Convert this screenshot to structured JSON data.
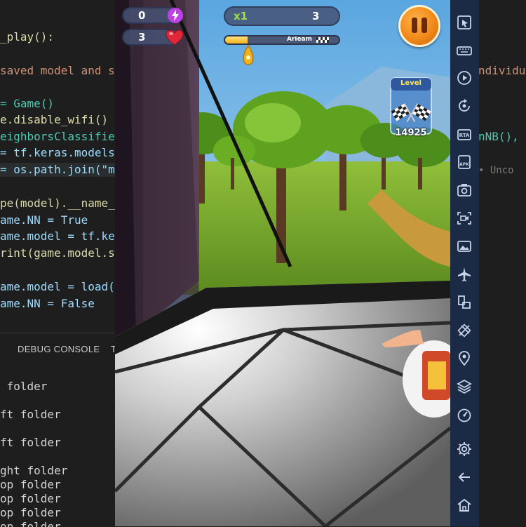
{
  "editor": {
    "code_lines": [
      "_play():",
      "",
      "saved model and s",
      "",
      "= Game()",
      "e.disable_wifi()",
      "eighborsClassifie",
      "= tf.keras.models",
      "= os.path.join(\"mo",
      "",
      "pe(model).__name__",
      "ame.NN = True",
      "ame.model = tf.ker",
      "rint(game.model.su",
      "",
      "ame.model = load(p",
      "ame.NN = False"
    ],
    "right_fragments": [
      "ndividu",
      "nNB(),",
      "• Unco"
    ]
  },
  "debug_panel": {
    "tab_label": "DEBUG CONSOLE",
    "tab_label_2": "T",
    "console_lines": [
      " folder",
      "ft folder",
      "ft folder",
      "ght folder",
      "op folder",
      "op folder",
      "op folder",
      "op folder"
    ]
  },
  "game": {
    "energy_count": "0",
    "lives_count": "3",
    "multiplier": "x1",
    "coins": "3",
    "progress_name": "Arleam",
    "progress_fraction": 0.2,
    "level_label": "Level",
    "level_score": "14925",
    "icons": {
      "energy": "lightning-icon",
      "lives": "heart-icon",
      "pause": "pause-icon",
      "marker": "location-drop-icon",
      "level": "checkered-flags-icon"
    }
  },
  "toolbar": {
    "buttons": [
      "pointer-icon",
      "keyboard-icon",
      "record-icon",
      "rotate-icon",
      "apk-icon",
      "apk-install-icon",
      "screenshot-icon",
      "screen-record-icon",
      "media-icon",
      "airplane-icon",
      "multi-instance-icon",
      "eco-mode-icon",
      "location-icon",
      "layers-icon",
      "performance-icon",
      "settings-icon",
      "back-icon",
      "home-icon"
    ]
  },
  "colors": {
    "toolbar_bg": "#1b2a45",
    "hud_pill": "#465273",
    "pause_orange": "#f08a1a",
    "progress_fill": "#f2b01e"
  }
}
